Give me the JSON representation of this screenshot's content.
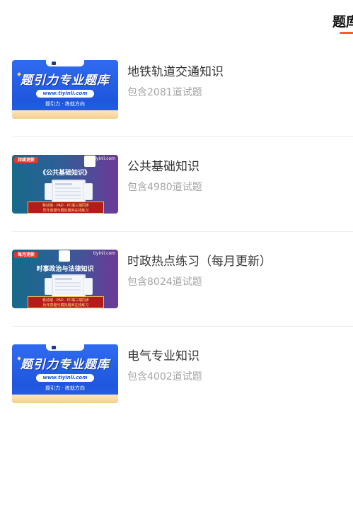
{
  "tab": {
    "label": "题库"
  },
  "items": [
    {
      "title": "地铁轨道交通知识",
      "count": "包含2081道试题",
      "thumb": {
        "style": "blue",
        "headline": "题引力专业题库",
        "url": "www.tiyinli.com",
        "slogan": "题引力 · 练就方向"
      }
    },
    {
      "title": "公共基础知识",
      "count": "包含4980道试题",
      "thumb": {
        "style": "purple",
        "tag": "持续更新",
        "brand": "tiyinli.com",
        "book": "《公共基础知识》",
        "line1": "移动端 · PAD · PC端三端同步",
        "line2": "历年真题与模拟题库在线练习"
      }
    },
    {
      "title": "时政热点练习（每月更新）",
      "count": "包含8024道试题",
      "thumb": {
        "style": "purple",
        "tag": "每月更新",
        "brand": "tiyinli.com",
        "book": "时事政治与法律知识",
        "line1": "移动端 · PAD · PC端三端同步",
        "line2": "历年真题与模拟题库在线练习"
      }
    },
    {
      "title": "电气专业知识",
      "count": "包含4002道试题",
      "thumb": {
        "style": "blue",
        "headline": "题引力专业题库",
        "url": "www.tiyinli.com",
        "slogan": "题引力 · 练就方向"
      }
    }
  ],
  "colors": {
    "accent": "#ff5a2c",
    "title": "#333333",
    "count": "#a6a6a6",
    "divider": "#ececec"
  }
}
